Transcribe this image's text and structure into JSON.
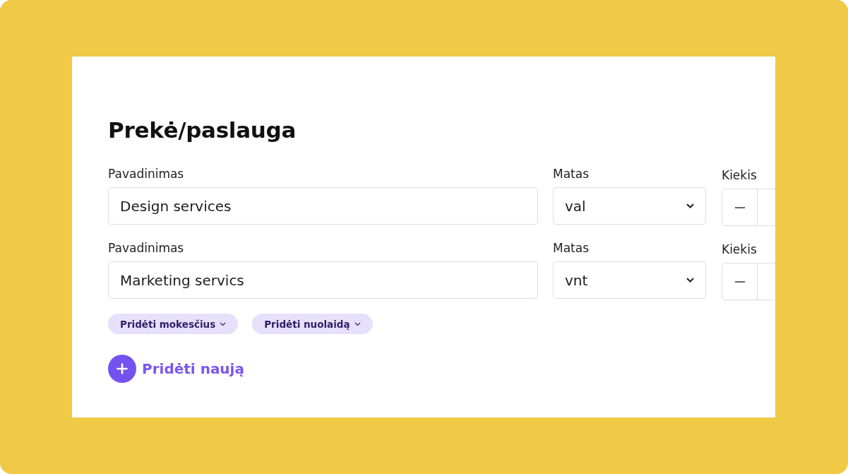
{
  "section_title": "Prekė/paslauga",
  "rows": [
    {
      "name_label": "Pavadinimas",
      "name_value": "Design services",
      "unit_label": "Matas",
      "unit_value": "val",
      "quantity_label": "Kiekis"
    },
    {
      "name_label": "Pavadinimas",
      "name_value": "Marketing servics",
      "unit_label": "Matas",
      "unit_value": "vnt",
      "quantity_label": "Kiekis"
    }
  ],
  "chips": [
    {
      "label": "Pridėti mokesčius"
    },
    {
      "label": "Pridėti nuolaidą"
    }
  ],
  "add_button": {
    "label": "Pridėti naują"
  }
}
